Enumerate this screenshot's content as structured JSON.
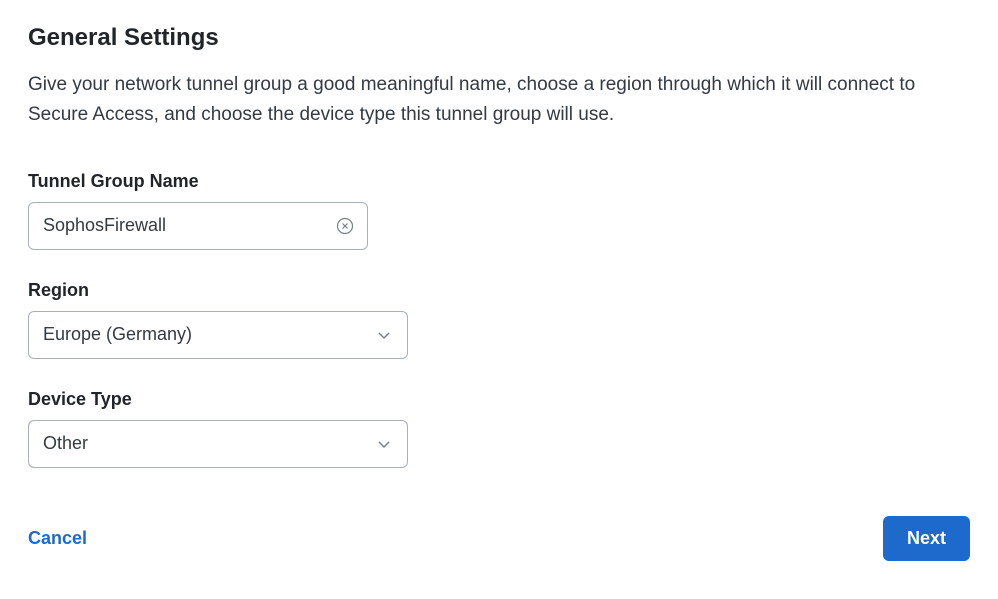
{
  "header": {
    "title": "General Settings",
    "description": "Give your network tunnel group a good meaningful name, choose a region through which it will connect to Secure Access, and choose the device type this tunnel group will use."
  },
  "form": {
    "tunnelGroupName": {
      "label": "Tunnel Group Name",
      "value": "SophosFirewall"
    },
    "region": {
      "label": "Region",
      "selected": "Europe (Germany)"
    },
    "deviceType": {
      "label": "Device Type",
      "selected": "Other"
    }
  },
  "footer": {
    "cancel": "Cancel",
    "next": "Next"
  }
}
